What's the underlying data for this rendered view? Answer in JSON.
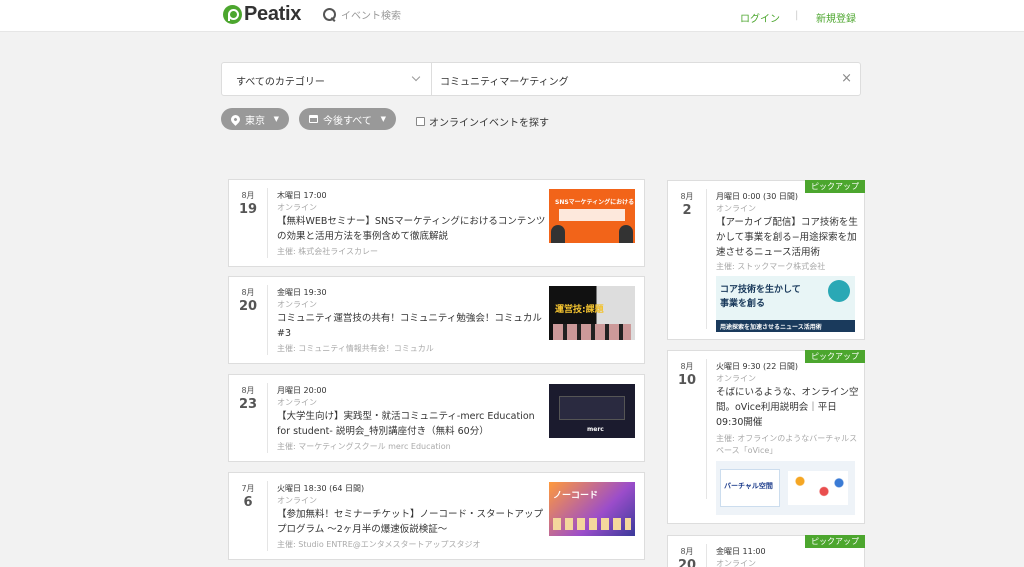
{
  "header": {
    "logo_text": "Peatix",
    "search_placeholder": "イベント検索",
    "login": "ログイン",
    "separator": "|",
    "signup": "新規登録"
  },
  "search": {
    "category": "すべてのカテゴリー",
    "keyword": "コミュニティマーケティング",
    "clear": "×"
  },
  "filters": {
    "location": "東京",
    "date": "今後すべて",
    "online_label": "オンラインイベントを探す"
  },
  "events": [
    {
      "month": "8月",
      "day": "19",
      "time": "木曜日 17:00",
      "type": "オンライン",
      "title": "【無料WEBセミナー】SNSマーケティングにおけるコンテンツの効果と活用方法を事例含めて徹底解説",
      "organizer": "主催: 株式会社ライスカレー",
      "thumb_text": "SNSマーケティングにおける"
    },
    {
      "month": "8月",
      "day": "20",
      "time": "金曜日 19:30",
      "type": "オンライン",
      "title": "コミュニティ運営技の共有！コミュニティ勉強会！コミュカル #3",
      "organizer": "主催: コミュニティ情報共有会！コミュカル",
      "thumb_text": "運営技:課題"
    },
    {
      "month": "8月",
      "day": "23",
      "time": "月曜日 20:00",
      "type": "オンライン",
      "title": "【大学生向け】実践型・就活コミュニティ-merc Education for student- 説明会_特別講座付き（無料 60分）",
      "organizer": "主催: マーケティングスクール merc Education",
      "thumb_text": "merc"
    },
    {
      "month": "7月",
      "day": "6",
      "time": "火曜日 18:30 (64 日間)",
      "type": "オンライン",
      "title": "【参加無料！セミナーチケット】ノーコード・スタートアッププログラム 〜2ヶ月半の爆速仮説検証〜",
      "organizer": "主催: Studio ENTRE@エンタメスタートアップスタジオ",
      "thumb_text": "ノーコード"
    }
  ],
  "pickups": [
    {
      "badge": "ピックアップ",
      "month": "8月",
      "day": "2",
      "time": "月曜日 0:00 (30 日間)",
      "type": "オンライン",
      "title": "【アーカイブ配信】コア技術を生かして事業を創る−用途探索を加速させるニュース活用術",
      "organizer": "主催: ストックマーク株式会社",
      "thumb_text1": "コア技術を生かして",
      "thumb_text2": "事業を創る",
      "thumb_text3": "用途探索を加速させるニュース活用術"
    },
    {
      "badge": "ピックアップ",
      "month": "8月",
      "day": "10",
      "time": "火曜日 9:30 (22 日間)",
      "type": "オンライン",
      "title": "そばにいるような、オンライン空間。oVice利用説明会｜平日09:30開催",
      "organizer": "主催: オフラインのようなバーチャルスペース「oVice」",
      "thumb_text": "バーチャル空間"
    },
    {
      "badge": "ピックアップ",
      "month": "8月",
      "day": "20",
      "time": "金曜日 11:00",
      "type": "オンライン"
    }
  ]
}
